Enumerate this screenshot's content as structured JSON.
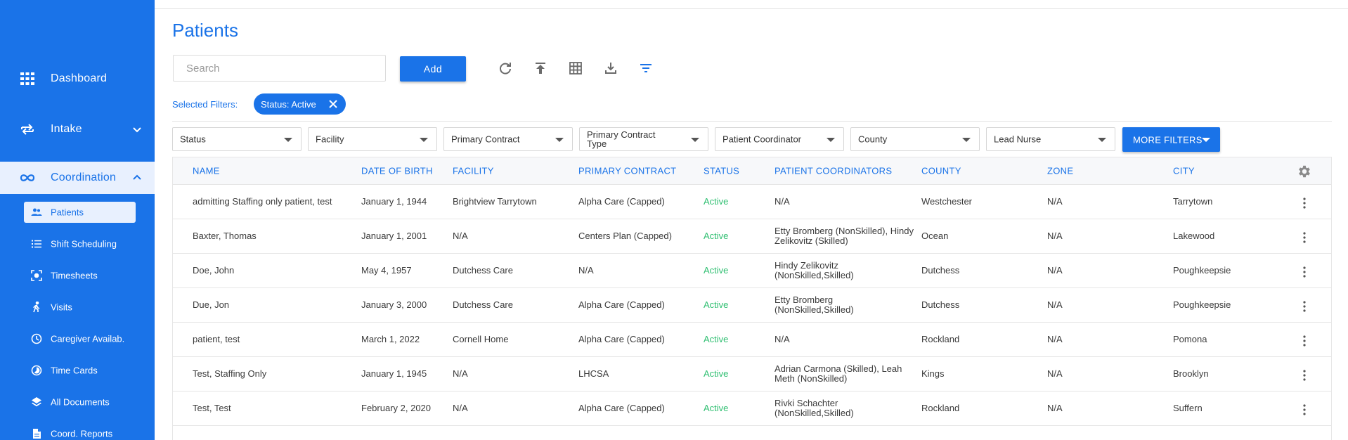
{
  "sidebar": {
    "brand_color": "#1a73e8",
    "main": [
      {
        "label": "Dashboard",
        "icon": "grid-icon"
      },
      {
        "label": "Intake",
        "icon": "swap-icon",
        "chevron": "down"
      },
      {
        "label": "Coordination",
        "icon": "infinity-icon",
        "chevron": "up",
        "active": true
      }
    ],
    "sub": [
      {
        "label": "Patients",
        "icon": "people-icon",
        "active": true
      },
      {
        "label": "Shift Scheduling",
        "icon": "list-icon"
      },
      {
        "label": "Timesheets",
        "icon": "scan-icon"
      },
      {
        "label": "Visits",
        "icon": "walk-icon"
      },
      {
        "label": "Caregiver Availab.",
        "icon": "clock-icon"
      },
      {
        "label": "Time Cards",
        "icon": "timelapse-icon"
      },
      {
        "label": "All Documents",
        "icon": "layers-icon"
      },
      {
        "label": "Coord. Reports",
        "icon": "document-icon"
      }
    ]
  },
  "page": {
    "title": "Patients"
  },
  "toolbar": {
    "search_placeholder": "Search",
    "add_label": "Add",
    "tools": [
      "refresh-icon",
      "upload-icon",
      "table-icon",
      "download-icon",
      "filter-icon"
    ]
  },
  "filters": {
    "selected_label": "Selected Filters:",
    "chips": [
      {
        "label": "Status: Active"
      }
    ],
    "dropdowns": [
      "Status",
      "Facility",
      "Primary Contract",
      "Primary Contract Type",
      "Patient Coordinator",
      "County",
      "Lead Nurse"
    ],
    "more_label": "MORE FILTERS"
  },
  "table": {
    "columns": [
      "NAME",
      "DATE OF BIRTH",
      "FACILITY",
      "PRIMARY CONTRACT",
      "STATUS",
      "PATIENT COORDINATORS",
      "COUNTY",
      "ZONE",
      "CITY"
    ],
    "status_color": "#2fbf71",
    "rows": [
      {
        "name": "admitting Staffing only patient, test",
        "dob": "January 1, 1944",
        "facility": "Brightview Tarrytown",
        "contract": "Alpha Care (Capped)",
        "status": "Active",
        "coordinators": "N/A",
        "county": "Westchester",
        "zone": "N/A",
        "city": "Tarrytown"
      },
      {
        "name": "Baxter, Thomas",
        "dob": "January 1, 2001",
        "facility": "N/A",
        "contract": "Centers Plan (Capped)",
        "status": "Active",
        "coordinators": "Etty Bromberg (NonSkilled), Hindy Zelikovitz (Skilled)",
        "county": "Ocean",
        "zone": "N/A",
        "city": "Lakewood"
      },
      {
        "name": "Doe, John",
        "dob": "May 4, 1957",
        "facility": "Dutchess Care",
        "contract": "N/A",
        "status": "Active",
        "coordinators": "Hindy Zelikovitz (NonSkilled,Skilled)",
        "county": "Dutchess",
        "zone": "N/A",
        "city": "Poughkeepsie"
      },
      {
        "name": "Due, Jon",
        "dob": "January 3, 2000",
        "facility": "Dutchess Care",
        "contract": "Alpha Care (Capped)",
        "status": "Active",
        "coordinators": "Etty Bromberg (NonSkilled,Skilled)",
        "county": "Dutchess",
        "zone": "N/A",
        "city": "Poughkeepsie"
      },
      {
        "name": "patient, test",
        "dob": "March 1, 2022",
        "facility": "Cornell Home",
        "contract": "Alpha Care (Capped)",
        "status": "Active",
        "coordinators": "N/A",
        "county": "Rockland",
        "zone": "N/A",
        "city": "Pomona"
      },
      {
        "name": "Test, Staffing Only",
        "dob": "January 1, 1945",
        "facility": "N/A",
        "contract": "LHCSA",
        "status": "Active",
        "coordinators": "Adrian Carmona (Skilled), Leah Meth (NonSkilled)",
        "county": "Kings",
        "zone": "N/A",
        "city": "Brooklyn"
      },
      {
        "name": "Test, Test",
        "dob": "February 2, 2020",
        "facility": "N/A",
        "contract": "Alpha Care (Capped)",
        "status": "Active",
        "coordinators": "Rivki Schachter (NonSkilled,Skilled)",
        "county": "Rockland",
        "zone": "N/A",
        "city": "Suffern"
      }
    ]
  }
}
